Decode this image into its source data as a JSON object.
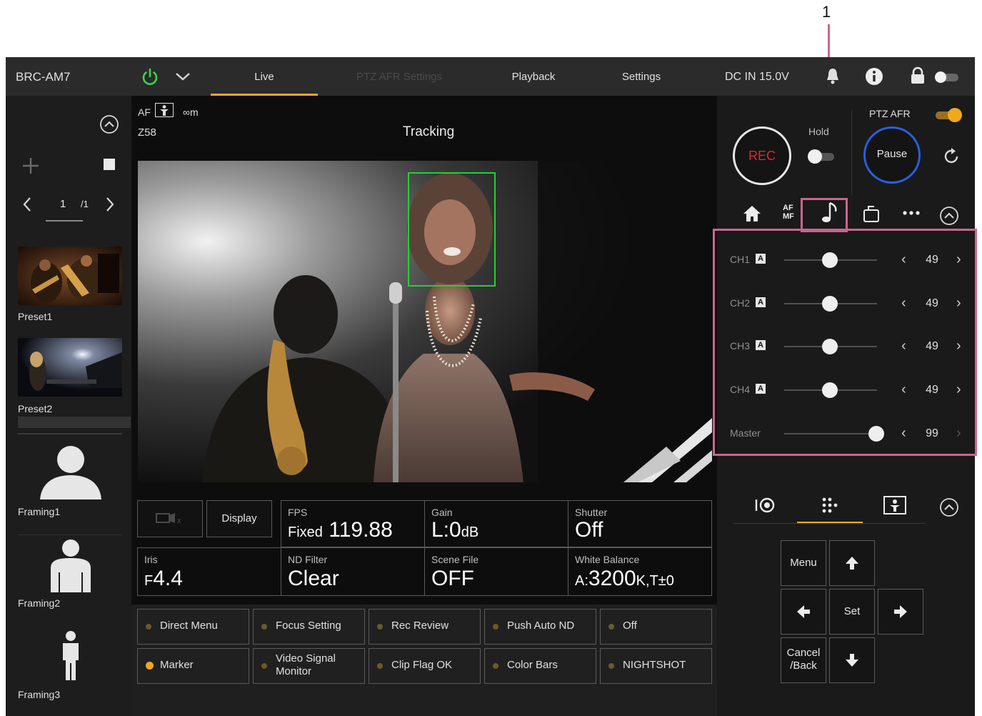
{
  "callout_number": "1",
  "header": {
    "model": "BRC-AM7",
    "tabs": [
      {
        "label": "Live",
        "state": "active"
      },
      {
        "label": "PTZ AFR Settings",
        "state": "disabled"
      },
      {
        "label": "Playback",
        "state": "normal"
      },
      {
        "label": "Settings",
        "state": "normal"
      }
    ],
    "power_status": "DC IN 15.0V",
    "icons": [
      "power-icon",
      "chevron-down-icon",
      "bell-icon",
      "info-icon",
      "lock-icon",
      "toggle-switch"
    ]
  },
  "sidebar": {
    "page_indicator": "1",
    "page_total": "/1",
    "presets": [
      {
        "label": "Preset1"
      },
      {
        "label": "Preset2"
      }
    ],
    "framings": [
      {
        "label": "Framing1"
      },
      {
        "label": "Framing2"
      },
      {
        "label": "Framing3"
      }
    ]
  },
  "video": {
    "af_label": "AF",
    "focus_distance": "∞m",
    "zoom": "Z58",
    "mode": "Tracking"
  },
  "status_panel": {
    "display_button": "Display",
    "cells": [
      {
        "label": "FPS",
        "prefix": "Fixed",
        "value": "119.88",
        "suffix": ""
      },
      {
        "label": "Gain",
        "prefix": "",
        "value": "L:0",
        "suffix": "dB"
      },
      {
        "label": "Shutter",
        "prefix": "",
        "value": "Off",
        "suffix": ""
      },
      {
        "label": "Iris",
        "prefix": "F",
        "value": "4.4",
        "suffix": ""
      },
      {
        "label": "ND Filter",
        "prefix": "",
        "value": "Clear",
        "suffix": ""
      },
      {
        "label": "Scene File",
        "prefix": "",
        "value": "OFF",
        "suffix": ""
      },
      {
        "label": "White Balance",
        "prefix": "A:",
        "value": "3200",
        "suffix": "K,T±0"
      }
    ]
  },
  "function_buttons": [
    {
      "label": "Direct Menu",
      "active": false
    },
    {
      "label": "Focus Setting",
      "active": false
    },
    {
      "label": "Rec Review",
      "active": false
    },
    {
      "label": "Push Auto ND",
      "active": false
    },
    {
      "label": "Off",
      "active": false
    },
    {
      "label": "Marker",
      "active": true
    },
    {
      "label": "Video Signal Monitor",
      "active": false
    },
    {
      "label": "Clip Flag OK",
      "active": false
    },
    {
      "label": "Color Bars",
      "active": false
    },
    {
      "label": "NIGHTSHOT",
      "active": false
    }
  ],
  "rec_panel": {
    "rec_label": "REC",
    "hold_label": "Hold",
    "ptz_afr_label": "PTZ AFR",
    "pause_label": "Pause"
  },
  "audio_panel": {
    "tabs": [
      "home-icon",
      "af-mf-icon",
      "audio-icon",
      "media-icon",
      "more-icon",
      "collapse-icon"
    ],
    "af_mf_text": "AF MF",
    "channels": [
      {
        "label": "CH1",
        "value": "49",
        "level": 0.49
      },
      {
        "label": "CH2",
        "value": "49",
        "level": 0.49
      },
      {
        "label": "CH3",
        "value": "49",
        "level": 0.49
      },
      {
        "label": "CH4",
        "value": "49",
        "level": 0.49
      },
      {
        "label": "Master",
        "value": "99",
        "level": 0.99
      }
    ]
  },
  "control_panel": {
    "menu": "Menu",
    "set": "Set",
    "cancel_back": "Cancel /Back"
  },
  "colors": {
    "accent": "#f0a91c",
    "rec_red": "#e0262a",
    "pause_blue": "#2a5fe0",
    "callout_pink": "#c9668f",
    "tracking_green": "#22d035"
  }
}
